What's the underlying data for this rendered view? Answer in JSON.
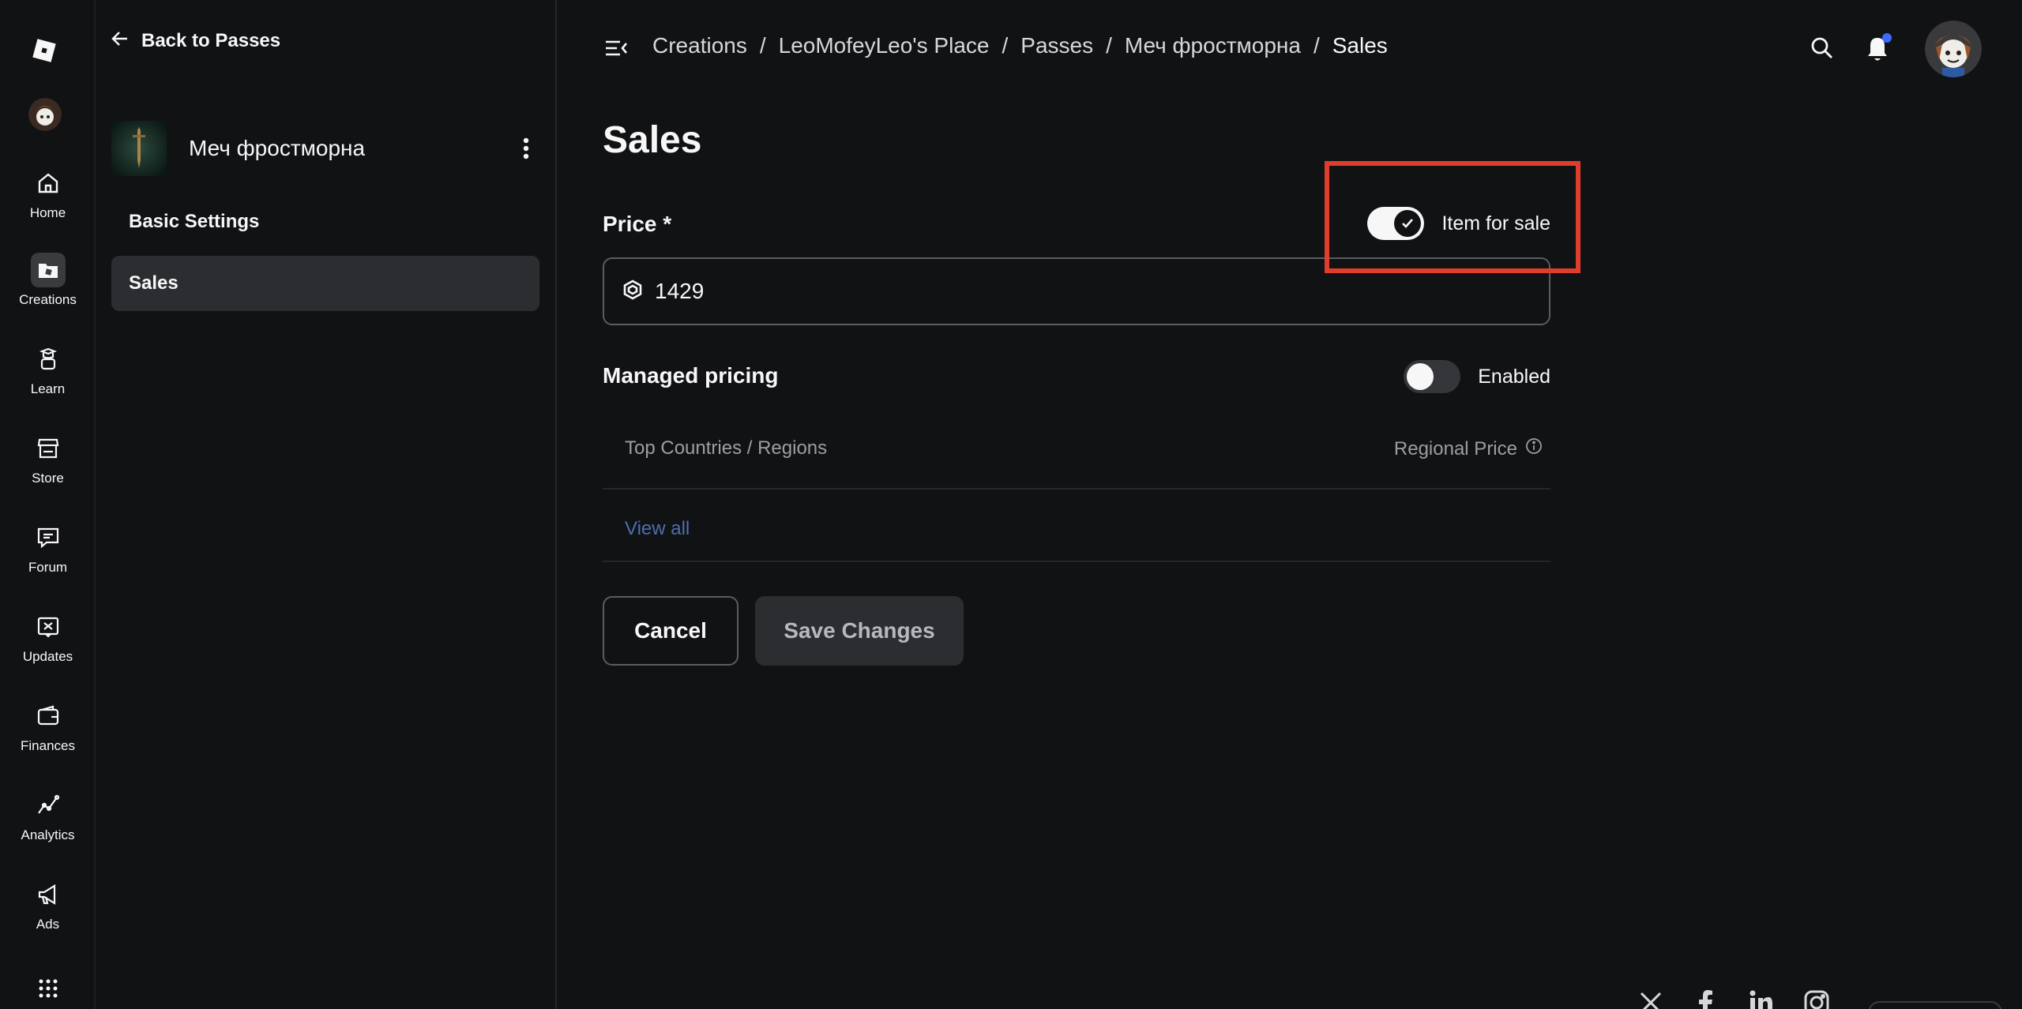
{
  "rail": {
    "items": [
      {
        "label": "Home",
        "icon": "home-icon"
      },
      {
        "label": "Creations",
        "icon": "creations-icon",
        "active": true
      },
      {
        "label": "Learn",
        "icon": "learn-icon"
      },
      {
        "label": "Store",
        "icon": "store-icon"
      },
      {
        "label": "Forum",
        "icon": "forum-icon"
      },
      {
        "label": "Updates",
        "icon": "updates-icon"
      },
      {
        "label": "Finances",
        "icon": "finances-icon"
      },
      {
        "label": "Analytics",
        "icon": "analytics-icon"
      },
      {
        "label": "Ads",
        "icon": "ads-icon"
      }
    ]
  },
  "sidebar": {
    "back_label": "Back to Passes",
    "item_name": "Меч фростморна",
    "nav": [
      {
        "label": "Basic Settings",
        "active": false
      },
      {
        "label": "Sales",
        "active": true
      }
    ]
  },
  "breadcrumb": [
    "Creations",
    "LeoMofeyLeo's Place",
    "Passes",
    "Меч фростморна",
    "Sales"
  ],
  "main": {
    "title": "Sales",
    "price_label": "Price *",
    "for_sale_label": "Item for sale",
    "for_sale_on": true,
    "price_value": "1429",
    "managed_label": "Managed pricing",
    "managed_toggle_label": "Enabled",
    "managed_on": false,
    "table_col1": "Top Countries / Regions",
    "table_col2": "Regional Price",
    "view_all": "View all",
    "cancel_label": "Cancel",
    "save_label": "Save Changes"
  },
  "colors": {
    "background": "#111214",
    "highlight": "#e03e2d",
    "link": "#4f6fb0",
    "notification": "#3b6cff"
  }
}
